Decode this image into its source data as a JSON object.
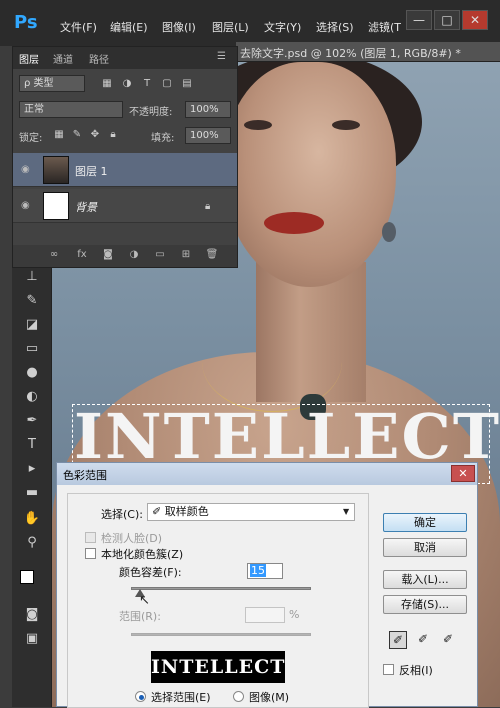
{
  "app": {
    "logo": "Ps"
  },
  "menu": [
    "文件(F)",
    "编辑(E)",
    "图像(I)",
    "图层(L)",
    "文字(Y)",
    "选择(S)",
    "滤镜(T"
  ],
  "window_controls": {
    "minimize": "—",
    "restore": "□",
    "close": "✕"
  },
  "document_tab": "去除文字.psd @ 102% (图层 1, RGB/8#) *",
  "canvas": {
    "overlay_text": "INTELLECT"
  },
  "layers_panel": {
    "tabs": [
      "图层",
      "通道",
      "路径"
    ],
    "filter_type": "ρ 类型",
    "blend_mode": "正常",
    "opacity_label": "不透明度:",
    "opacity_value": "100%",
    "lock_label": "锁定:",
    "fill_label": "填充:",
    "fill_value": "100%",
    "layers": [
      {
        "name": "图层 1",
        "selected": true
      },
      {
        "name": "背景",
        "locked": true
      }
    ],
    "footer_icons": [
      "link-icon",
      "fx-icon",
      "mask-icon",
      "adjustment-icon",
      "folder-icon",
      "new-layer-icon",
      "trash-icon"
    ]
  },
  "dialog": {
    "title": "色彩范围",
    "close": "✕",
    "select_label": "选择(C):",
    "select_value": "取样颜色",
    "detect_faces": "检测人脸(D)",
    "localized_clusters": "本地化颜色簇(Z)",
    "fuzziness_label": "颜色容差(F):",
    "fuzziness_value": "15",
    "range_label": "范围(R):",
    "range_unit": "%",
    "preview_text": "INTELLECT",
    "radio_selection": "选择范围(E)",
    "radio_image": "图像(M)",
    "buttons": {
      "ok": "确定",
      "cancel": "取消",
      "load": "载入(L)...",
      "save": "存储(S)..."
    },
    "invert": "反相(I)"
  },
  "colors": {
    "accent": "#31a8ff",
    "selected_layer": "#5d6a80",
    "dialog_bg": "#f0f0f0"
  }
}
